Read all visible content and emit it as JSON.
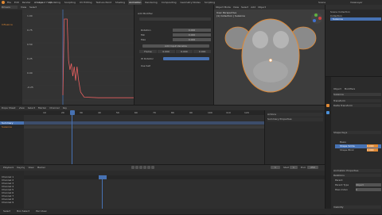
{
  "app": {
    "menu": [
      "File",
      "Edit",
      "Render",
      "Window",
      "Help"
    ],
    "workspaces": [
      "Layout",
      "Modeling",
      "Sculpting",
      "UV Editing",
      "Texture Paint",
      "Shading",
      "Animation",
      "Rendering",
      "Compositing",
      "Geometry Nodes",
      "Scripting"
    ],
    "active_workspace": "Animation",
    "scene": "Scene",
    "view_layer": "ViewLayer"
  },
  "graph": {
    "mode": "Drivers",
    "view": "View",
    "select": "Select",
    "marker": "Marker",
    "channel": "Channel",
    "key": "Key",
    "channel_item": "Influence",
    "y_labels": [
      "1.00",
      "0.75",
      "0.50",
      "0.25",
      "0.00",
      "-0.25"
    ],
    "curve": [
      [
        0,
        0.05
      ],
      [
        0.02,
        1.25
      ],
      [
        0.06,
        1.25
      ],
      [
        0.08,
        0.6
      ],
      [
        0.1,
        0.45
      ],
      [
        0.12,
        0.55
      ],
      [
        0.14,
        0.35
      ],
      [
        0.16,
        0.5
      ],
      [
        0.18,
        0.28
      ],
      [
        0.2,
        0.5
      ],
      [
        0.22,
        0.3
      ],
      [
        0.25,
        0.1
      ],
      [
        0.3,
        0.02
      ],
      [
        0.5,
        0.01
      ],
      [
        1,
        0.01
      ]
    ]
  },
  "driver": {
    "title": "Add Modifier",
    "rows": [
      {
        "label": "Rotation",
        "value": "0.000"
      },
      {
        "label": "Min",
        "value": "0.000"
      },
      {
        "label": "Max",
        "value": "0.000"
      }
    ],
    "panel_btn": "Add Input Variable",
    "cols": [
      "Frame",
      "0.000",
      "0.000",
      "0.000"
    ],
    "var_label": "W Rotation",
    "checkbox": "Use Self"
  },
  "viewport": {
    "header": [
      "Object Mode",
      "View",
      "Select",
      "Add",
      "Object"
    ],
    "info": "User Perspective",
    "collection": "(1) Collection | Suzanne"
  },
  "timeline": {
    "menus": [
      "Dope Sheet",
      "View",
      "Select",
      "Marker",
      "Channel",
      "Key"
    ],
    "ticks": [
      "10",
      "20",
      "30",
      "40",
      "50",
      "60",
      "70",
      "80",
      "90",
      "100",
      "110",
      "120"
    ],
    "current_frame": "1",
    "summary": "Summary",
    "object": "Suzanne",
    "panel_items": [
      "Actions",
      "Summary Properties"
    ]
  },
  "nla": {
    "menus": [
      "Playback",
      "Keying",
      "View",
      "Marker"
    ],
    "frame": "1",
    "start_label": "Start",
    "start": "1",
    "end_label": "End",
    "end": "250",
    "sidebar_items": [
      "Channel 1",
      "Channel 2",
      "Channel 3",
      "Channel 4",
      "Channel 5",
      "Channel 6",
      "Channel 7",
      "Channel 8",
      "Channel 9"
    ],
    "status": [
      "Select",
      "Box Select",
      "Pan View"
    ]
  },
  "properties": {
    "outliner_title": "Scene Collection",
    "outliner_items": [
      "Collection",
      "Suzanne"
    ],
    "object": "Suzanne",
    "tabs": [
      "Object",
      "Modifiers"
    ],
    "sections": [
      "Transform",
      "Delta Transform",
      "Shape Keys",
      "Animation Properties",
      "Relations",
      "Visibility"
    ],
    "shape_keys": [
      {
        "name": "Basis",
        "value": ""
      },
      {
        "name": "Shape Smile",
        "value": "0.000"
      },
      {
        "name": "Shape Blink",
        "value": "0.000"
      }
    ],
    "relations": [
      {
        "label": "Parent",
        "value": ""
      },
      {
        "label": "Parent Type",
        "value": "Object"
      },
      {
        "label": "Pass Index",
        "value": "0"
      }
    ],
    "accent": "#e08934",
    "selection": "#4772b3"
  }
}
